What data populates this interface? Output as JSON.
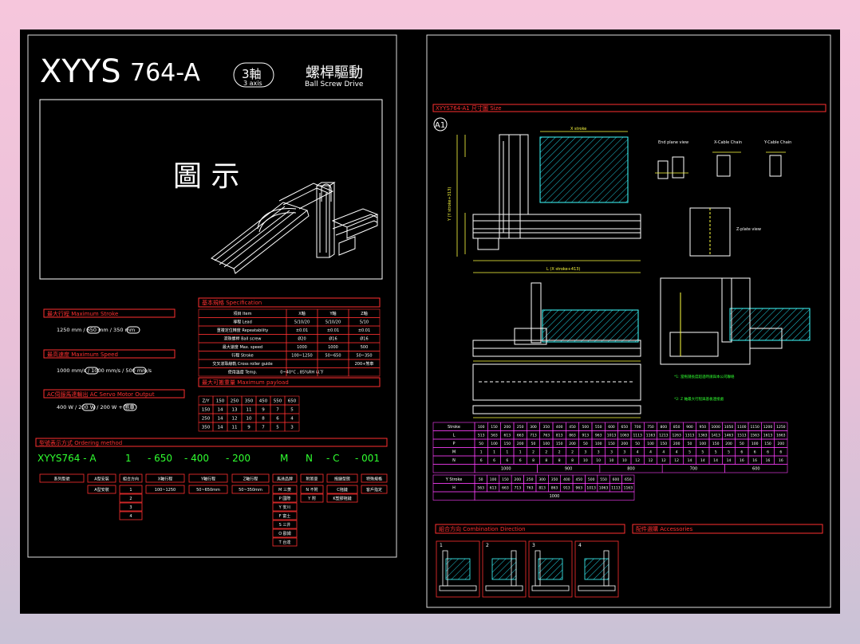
{
  "left": {
    "title_main": "XYYS",
    "title_model": "764-A",
    "axes_badge": "3軸",
    "axes_badge_en": "3 axis",
    "drive_zh": "螺桿驅動",
    "drive_en": "Ball Screw Drive",
    "figure_label": "圖 示",
    "max_stroke_title": "最大行程 Maximum Stroke",
    "max_stroke_line": "1250 mm  /  650 mm  /  350 mm",
    "max_speed_title": "最高速度 Maximum Speed",
    "max_speed_line": "1000 mm/s  /  1000 mm/s  /  500 mm/s",
    "servo_title": "AC伺服馬達輸出 AC Servo Motor Output",
    "servo_line": "400 W  /  200 W  /  200 W + 煞車",
    "spec_title": "基本規格 Specification",
    "spec_headers": [
      "項目 Item",
      "X軸",
      "Y軸",
      "Z軸"
    ],
    "spec_rows": [
      [
        "導程 Lead",
        "5/10/20",
        "5/10/20",
        "5/10"
      ],
      [
        "重複定位精度 Repeatability",
        "±0.01",
        "±0.01",
        "±0.01"
      ],
      [
        "滾珠螺桿 Ball screw",
        "Ø20",
        "Ø16",
        "Ø16"
      ],
      [
        "最大速度 Max. speed",
        "1000",
        "1000",
        "500"
      ],
      [
        "行程 Stroke",
        "100~1250",
        "50~650",
        "50~350"
      ],
      [
        "交叉滾珠線軌 Cross roller guide",
        "",
        "",
        "200+煞車"
      ],
      [
        "使用溫度 Temp.",
        "0~40°C , 85%RH 以下",
        "",
        ""
      ]
    ],
    "payload_title": "最大可搬重量 Maximum payload",
    "payload_headers": [
      "Z/Y",
      "150",
      "250",
      "350",
      "450",
      "550",
      "650"
    ],
    "payload_rows": [
      [
        "150",
        "14",
        "13",
        "11",
        "9",
        "7",
        "5"
      ],
      [
        "250",
        "14",
        "12",
        "10",
        "8",
        "6",
        "4"
      ],
      [
        "350",
        "14",
        "11",
        "9",
        "7",
        "5",
        "3"
      ]
    ],
    "order_title": "型號表示方式 Ordering method",
    "order_code": [
      "XYYS764 - A",
      "1",
      "- 650",
      "- 400",
      "- 200",
      "M",
      "N",
      "- C",
      "- 001"
    ],
    "order_boxes": [
      "系列型號",
      "A型安裝",
      "組合方向",
      "X軸行程",
      "Y軸行程",
      "Z軸行程",
      "馬達品牌",
      "附煞車",
      "拖鏈型態",
      "特殊規格"
    ],
    "order_values": [
      "A型安裝",
      "100~1250",
      "50~650mm",
      "50~350mm",
      "C拖鏈",
      "K塑膠拖鏈",
      "客戶指定"
    ],
    "order_dirs": [
      "1",
      "2",
      "3",
      "4"
    ],
    "order_brands": [
      "M 三菱",
      "P 國際",
      "Y 安川",
      "F 富士",
      "S 三井",
      "O 歐姆",
      "T 台達"
    ],
    "order_brake": [
      "N 不附",
      "Y 附"
    ]
  },
  "right": {
    "dim_title": "XYYS764-A1 尺寸圖 Size",
    "callout": "A1",
    "labels": {
      "stroke": "X stroke",
      "ylabel": "Y (Y stroke+313)",
      "xlabel": "L (X stroke+413)",
      "end_view": "End plane view",
      "xchain": "X-Cable Chain",
      "ychain": "Y-Cable Chain",
      "side_view": "Z-plate view",
      "note1": "*1: 當拖鏈長度超過時請與本公司聯絡",
      "note2": "*2: Z 軸最大行程與基板連接處"
    },
    "stroke_row": [
      "100",
      "150",
      "200",
      "250",
      "300",
      "350",
      "400",
      "450",
      "500",
      "550",
      "600",
      "650",
      "700",
      "750",
      "800",
      "850",
      "900",
      "950",
      "1000",
      "1050",
      "1100",
      "1150",
      "1200",
      "1250"
    ],
    "L_row": [
      "513",
      "563",
      "613",
      "663",
      "713",
      "763",
      "813",
      "863",
      "913",
      "963",
      "1013",
      "1063",
      "1113",
      "1163",
      "1213",
      "1263",
      "1313",
      "1363",
      "1413",
      "1463",
      "1513",
      "1563",
      "1613",
      "1663"
    ],
    "P_row": [
      "50",
      "100",
      "150",
      "200",
      "50",
      "100",
      "150",
      "200",
      "50",
      "100",
      "150",
      "200",
      "50",
      "100",
      "150",
      "200",
      "50",
      "100",
      "150",
      "200",
      "50",
      "100",
      "150",
      "200"
    ],
    "M_row": [
      "1",
      "1",
      "1",
      "1",
      "2",
      "2",
      "2",
      "2",
      "3",
      "3",
      "3",
      "3",
      "4",
      "4",
      "4",
      "4",
      "5",
      "5",
      "5",
      "5",
      "6",
      "6",
      "6",
      "6"
    ],
    "N_row": [
      "6",
      "6",
      "6",
      "6",
      "8",
      "8",
      "8",
      "8",
      "10",
      "10",
      "10",
      "10",
      "12",
      "12",
      "12",
      "12",
      "14",
      "14",
      "14",
      "14",
      "16",
      "16",
      "16",
      "16"
    ],
    "speed_row": [
      "1000",
      "900",
      "800",
      "700",
      "600"
    ],
    "y_stroke_row": [
      "50",
      "100",
      "150",
      "200",
      "250",
      "300",
      "350",
      "400",
      "450",
      "500",
      "550",
      "600",
      "650"
    ],
    "H_row": [
      "563",
      "613",
      "663",
      "713",
      "763",
      "813",
      "863",
      "913",
      "963",
      "1013",
      "1063",
      "1113",
      "1163"
    ],
    "y_speed": "1000",
    "combination_title": "組合方向 Combination Direction",
    "accessories_title": "配件選購 Accessories",
    "combos": [
      "1",
      "2",
      "3",
      "4"
    ]
  }
}
